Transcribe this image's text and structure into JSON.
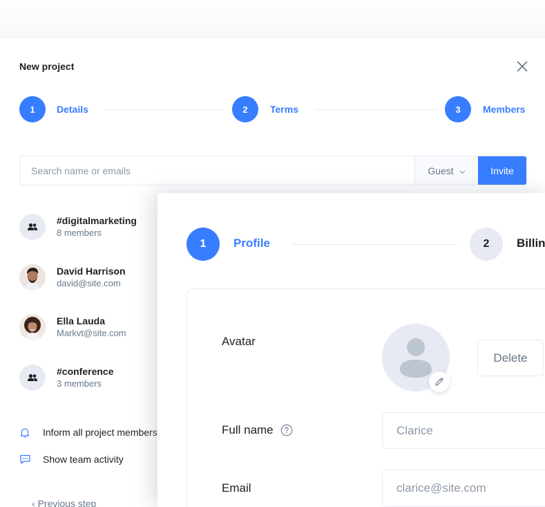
{
  "modal_back": {
    "title": "New project",
    "steps": [
      {
        "number": "1",
        "label": "Details"
      },
      {
        "number": "2",
        "label": "Terms"
      },
      {
        "number": "3",
        "label": "Members"
      }
    ],
    "search": {
      "placeholder": "Search name or emails"
    },
    "role_select": {
      "value": "Guest"
    },
    "invite_label": "Invite",
    "members": [
      {
        "name": "#digitalmarketing",
        "sub": "8 members",
        "avatar": "group-icon"
      },
      {
        "name": "David Harrison",
        "sub": "david@site.com",
        "avatar": "photo"
      },
      {
        "name": "Ella Lauda",
        "sub": "Markvt@site.com",
        "avatar": "photo"
      },
      {
        "name": "#conference",
        "sub": "3 members",
        "avatar": "group-icon"
      }
    ],
    "options": [
      {
        "label": "Inform all project members",
        "icon": "bell-icon"
      },
      {
        "label": "Show team activity",
        "icon": "chat-icon"
      }
    ],
    "previous_step": "Previous step"
  },
  "modal_front": {
    "steps": [
      {
        "number": "1",
        "label": "Profile"
      },
      {
        "number": "2",
        "label": "Billing"
      }
    ],
    "form": {
      "avatar_label": "Avatar",
      "delete_label": "Delete",
      "full_name_label": "Full name",
      "full_name_placeholder": "Clarice",
      "email_label": "Email",
      "email_placeholder": "clarice@site.com"
    }
  },
  "colors": {
    "primary": "#377dff",
    "border": "#e7eaf3",
    "muted": "#677788",
    "dark": "#1e2022"
  }
}
